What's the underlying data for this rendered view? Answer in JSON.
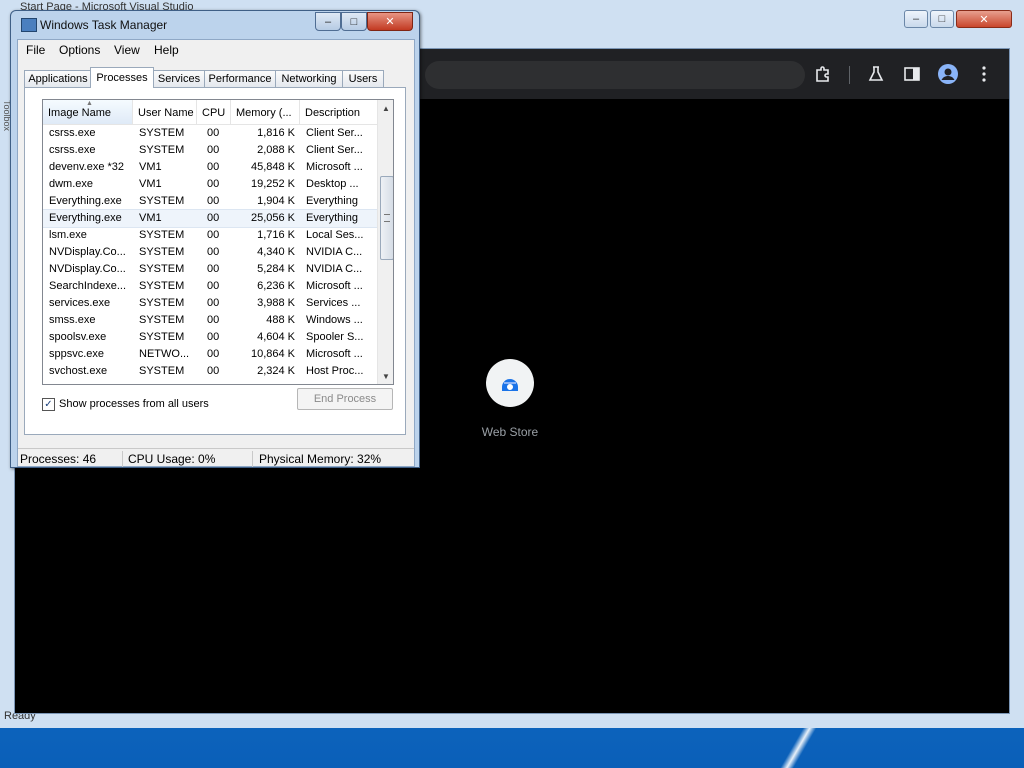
{
  "background_window": {
    "title": "Start Page - Microsoft Visual Studio",
    "status": "Ready",
    "side_tab": "Toolbox",
    "controls": {
      "minimize": "–",
      "maximize": "□",
      "close": "✕"
    }
  },
  "chrome": {
    "controls": {
      "minimize": "–",
      "maximize": "□",
      "close": "✕"
    },
    "toolbar_icons": [
      "extensions-icon",
      "labs-icon",
      "side-panel-icon",
      "profile-icon",
      "menu-icon"
    ],
    "shortcut": {
      "label": "Web Store"
    }
  },
  "task_manager": {
    "title": "Windows Task Manager",
    "controls": {
      "minimize": "–",
      "maximize": "□",
      "close": "✕"
    },
    "menu": [
      "File",
      "Options",
      "View",
      "Help"
    ],
    "tabs": [
      "Applications",
      "Processes",
      "Services",
      "Performance",
      "Networking",
      "Users"
    ],
    "active_tab": "Processes",
    "columns": [
      "Image Name",
      "User Name",
      "CPU",
      "Memory (...",
      "Description"
    ],
    "processes": [
      {
        "name": "csrss.exe",
        "user": "SYSTEM",
        "cpu": "00",
        "memory": "1,816 K",
        "description": "Client Ser..."
      },
      {
        "name": "csrss.exe",
        "user": "SYSTEM",
        "cpu": "00",
        "memory": "2,088 K",
        "description": "Client Ser..."
      },
      {
        "name": "devenv.exe *32",
        "user": "VM1",
        "cpu": "00",
        "memory": "45,848 K",
        "description": "Microsoft ..."
      },
      {
        "name": "dwm.exe",
        "user": "VM1",
        "cpu": "00",
        "memory": "19,252 K",
        "description": "Desktop ..."
      },
      {
        "name": "Everything.exe",
        "user": "SYSTEM",
        "cpu": "00",
        "memory": "1,904 K",
        "description": "Everything"
      },
      {
        "name": "Everything.exe",
        "user": "VM1",
        "cpu": "00",
        "memory": "25,056 K",
        "description": "Everything"
      },
      {
        "name": "lsm.exe",
        "user": "SYSTEM",
        "cpu": "00",
        "memory": "1,716 K",
        "description": "Local Ses..."
      },
      {
        "name": "NVDisplay.Co...",
        "user": "SYSTEM",
        "cpu": "00",
        "memory": "4,340 K",
        "description": "NVIDIA C..."
      },
      {
        "name": "NVDisplay.Co...",
        "user": "SYSTEM",
        "cpu": "00",
        "memory": "5,284 K",
        "description": "NVIDIA C..."
      },
      {
        "name": "SearchIndexe...",
        "user": "SYSTEM",
        "cpu": "00",
        "memory": "6,236 K",
        "description": "Microsoft ..."
      },
      {
        "name": "services.exe",
        "user": "SYSTEM",
        "cpu": "00",
        "memory": "3,988 K",
        "description": "Services ..."
      },
      {
        "name": "smss.exe",
        "user": "SYSTEM",
        "cpu": "00",
        "memory": "488 K",
        "description": "Windows ..."
      },
      {
        "name": "spoolsv.exe",
        "user": "SYSTEM",
        "cpu": "00",
        "memory": "4,604 K",
        "description": "Spooler S..."
      },
      {
        "name": "sppsvc.exe",
        "user": "NETWO...",
        "cpu": "00",
        "memory": "10,864 K",
        "description": "Microsoft ..."
      },
      {
        "name": "svchost.exe",
        "user": "SYSTEM",
        "cpu": "00",
        "memory": "2,324 K",
        "description": "Host Proc..."
      }
    ],
    "selected_row_index": 5,
    "show_all_users": {
      "label": "Show processes from all users",
      "checked": true,
      "mark": "✓"
    },
    "end_process_label": "End Process",
    "status": {
      "processes": "Processes: 46",
      "cpu": "CPU Usage: 0%",
      "memory": "Physical Memory: 32%"
    }
  }
}
